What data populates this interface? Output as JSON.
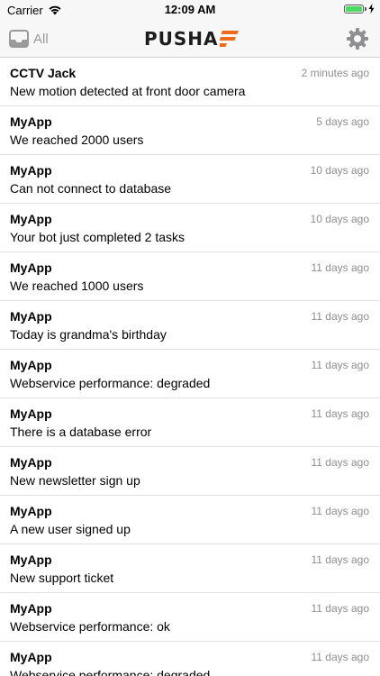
{
  "status_bar": {
    "carrier": "Carrier",
    "time": "12:09 AM",
    "battery_level": 1.0
  },
  "nav": {
    "inbox_label": "All",
    "logo_text": "PUSHA",
    "icons": {
      "left": "inbox-tray-icon",
      "right": "gear-icon",
      "logo": "pusha-logo-mark"
    },
    "brand_color": "#f06a1c"
  },
  "notifications": [
    {
      "app": "CCTV Jack",
      "time": "2 minutes ago",
      "message": "New motion detected at front door camera"
    },
    {
      "app": "MyApp",
      "time": "5 days ago",
      "message": "We reached 2000 users"
    },
    {
      "app": "MyApp",
      "time": "10 days ago",
      "message": "Can not connect to database"
    },
    {
      "app": "MyApp",
      "time": "10 days ago",
      "message": "Your bot just completed 2 tasks"
    },
    {
      "app": "MyApp",
      "time": "11 days ago",
      "message": "We reached 1000 users"
    },
    {
      "app": "MyApp",
      "time": "11 days ago",
      "message": "Today is grandma's birthday"
    },
    {
      "app": "MyApp",
      "time": "11 days ago",
      "message": "Webservice performance: degraded"
    },
    {
      "app": "MyApp",
      "time": "11 days ago",
      "message": "There is a database error"
    },
    {
      "app": "MyApp",
      "time": "11 days ago",
      "message": "New newsletter sign up"
    },
    {
      "app": "MyApp",
      "time": "11 days ago",
      "message": "A new user signed up"
    },
    {
      "app": "MyApp",
      "time": "11 days ago",
      "message": "New support ticket"
    },
    {
      "app": "MyApp",
      "time": "11 days ago",
      "message": "Webservice performance: ok"
    },
    {
      "app": "MyApp",
      "time": "11 days ago",
      "message": "Webservice performance: degraded"
    }
  ]
}
